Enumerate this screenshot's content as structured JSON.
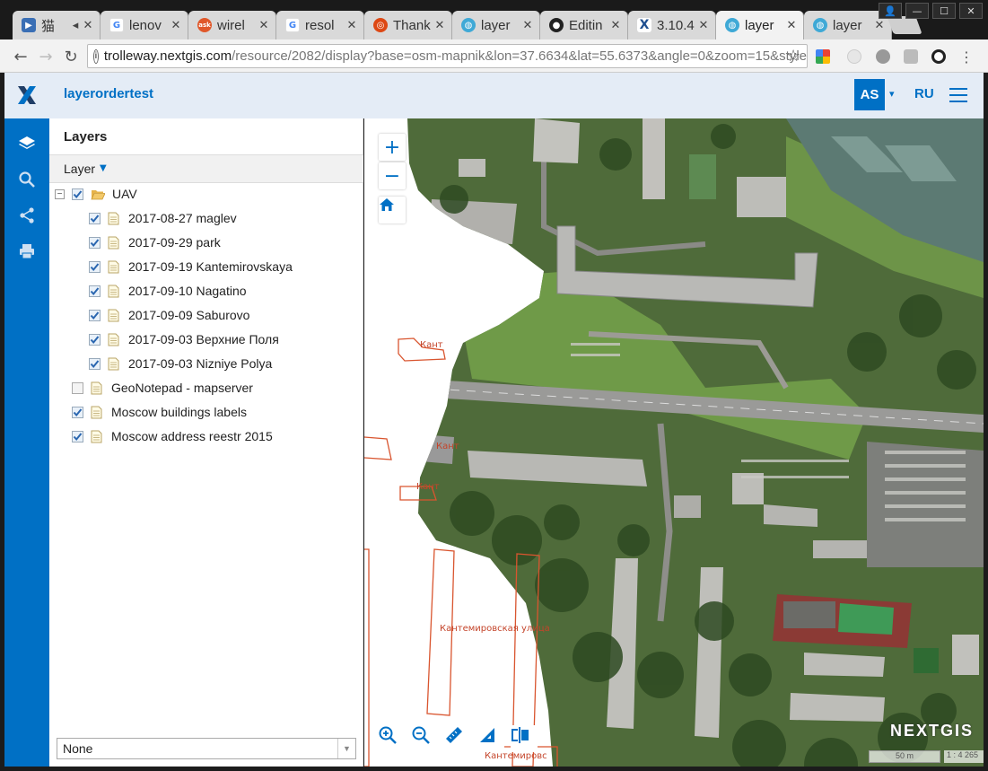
{
  "browser": {
    "tabs": [
      {
        "title": "猫",
        "favicon": "play-icon",
        "color": "#3a6fb5"
      },
      {
        "title": "lenov",
        "favicon": "google-icon",
        "color": "#ffffff"
      },
      {
        "title": "wirel",
        "favicon": "ask-icon",
        "color": "#e0582a"
      },
      {
        "title": "resol",
        "favicon": "google-icon",
        "color": "#ffffff"
      },
      {
        "title": "Thank",
        "favicon": "ubuntu-icon",
        "color": "#dd4814"
      },
      {
        "title": "layer",
        "favicon": "globe-icon",
        "color": "#3fa9d6"
      },
      {
        "title": "Editin",
        "favicon": "github-icon",
        "color": "#222222"
      },
      {
        "title": "3.10.4",
        "favicon": "nextgis-icon",
        "color": "#1f4f8f"
      },
      {
        "title": "layer",
        "favicon": "globe-icon",
        "color": "#3fa9d6"
      },
      {
        "title": "layer",
        "favicon": "globe-icon",
        "color": "#3fa9d6"
      }
    ],
    "url_host": "trolleway.nextgis.com",
    "url_path": "/resource/2082/display?base=osm-mapnik&lon=37.6634&lat=55.6373&angle=0&zoom=15&style"
  },
  "app": {
    "title": "layerordertest",
    "user_initials": "AS",
    "language": "RU",
    "accent": "#0070c5"
  },
  "panel": {
    "title": "Layers",
    "toolbar_label": "Layer",
    "group": {
      "label": "UAV",
      "checked": true,
      "expanded": true
    },
    "group_children": [
      {
        "label": "2017-08-27 maglev",
        "checked": true
      },
      {
        "label": "2017-09-29 park",
        "checked": true
      },
      {
        "label": "2017-09-19 Kantemirovskaya",
        "checked": true
      },
      {
        "label": "2017-09-10 Nagatino",
        "checked": true
      },
      {
        "label": "2017-09-09 Saburovo",
        "checked": true
      },
      {
        "label": "2017-09-03 Верхние Поля",
        "checked": true
      },
      {
        "label": "2017-09-03 Nizniye Polya",
        "checked": true
      }
    ],
    "layers": [
      {
        "label": "GeoNotepad - mapserver",
        "checked": false
      },
      {
        "label": "Moscow buildings labels",
        "checked": true
      },
      {
        "label": "Moscow address reestr 2015",
        "checked": true
      }
    ],
    "basemap_select": "None"
  },
  "map": {
    "brand": "NEXTGIS",
    "scale_label": "50 m",
    "scale_ratio": "1 : 4 265",
    "street_labels": [
      "Кантемировская улица",
      "Кант",
      "Кантемировс",
      "Кант",
      "Кант"
    ]
  }
}
